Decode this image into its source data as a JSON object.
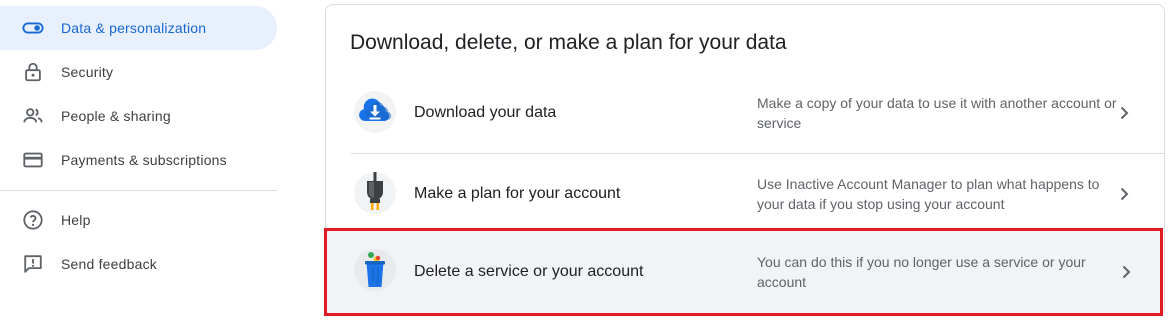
{
  "sidebar": {
    "items": [
      {
        "label": "Data & personalization",
        "icon": "toggle-icon",
        "active": true
      },
      {
        "label": "Security",
        "icon": "lock-icon"
      },
      {
        "label": "People & sharing",
        "icon": "people-icon"
      },
      {
        "label": "Payments & subscriptions",
        "icon": "credit-card-icon"
      },
      {
        "label": "Help",
        "icon": "help-icon"
      },
      {
        "label": "Send feedback",
        "icon": "feedback-icon"
      }
    ]
  },
  "card": {
    "title": "Download, delete, or make a plan for your data",
    "rows": [
      {
        "label": "Download your data",
        "description": "Make a copy of your data to use it with another account or service",
        "icon": "cloud-download-icon"
      },
      {
        "label": "Make a plan for your account",
        "description": "Use Inactive Account Manager to plan what happens to your data if you stop using your account",
        "icon": "power-plug-icon"
      },
      {
        "label": "Delete a service or your account",
        "description": "You can do this if you no longer use a service or your account",
        "icon": "trash-bin-icon",
        "highlighted": true
      }
    ]
  },
  "colors": {
    "accent": "#1967d2",
    "active_bg": "#e8f0fe",
    "highlight_border": "#e11b22",
    "text_primary": "#202124",
    "text_secondary": "#5f6368"
  }
}
